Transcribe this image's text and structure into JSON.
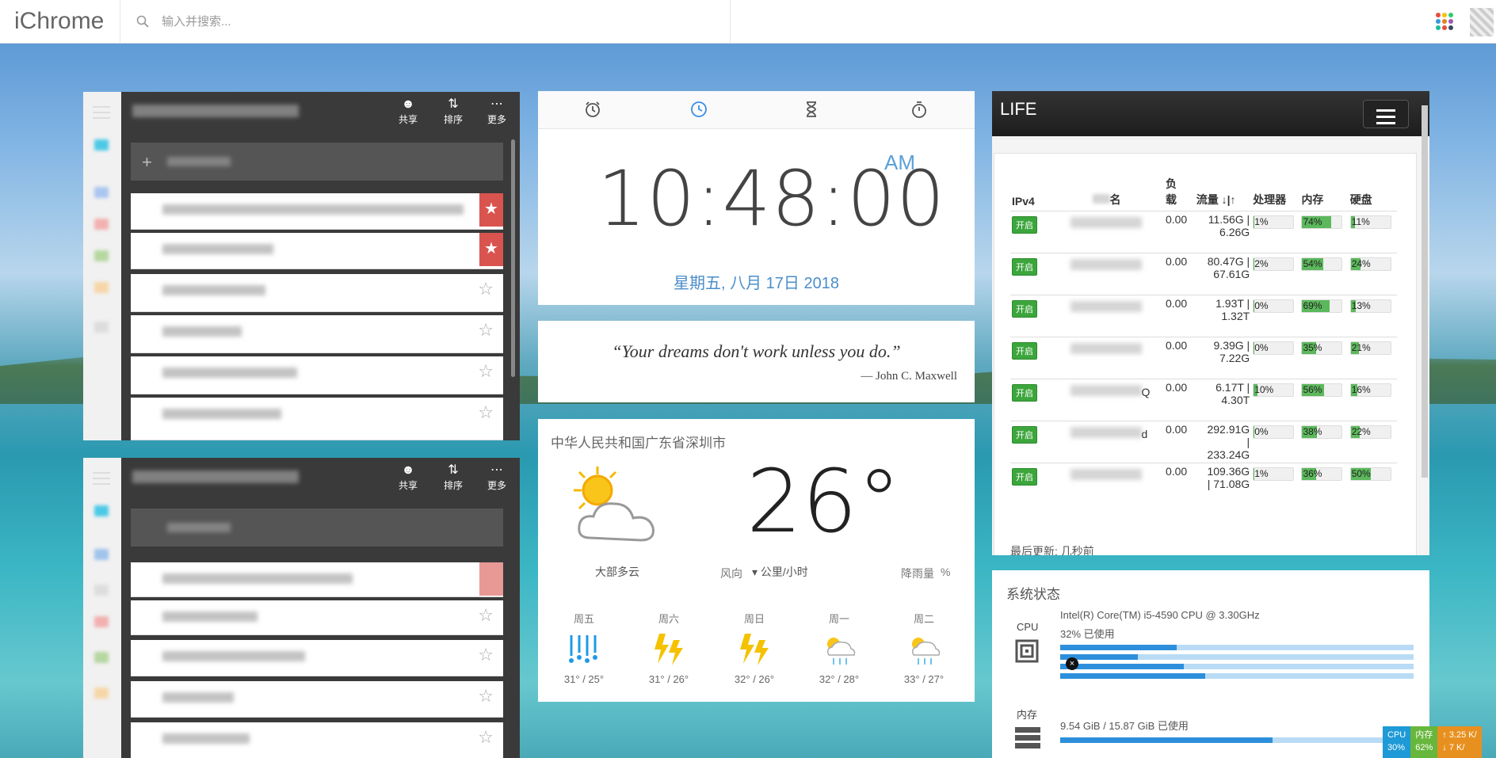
{
  "app": {
    "logo": "iChrome"
  },
  "search": {
    "placeholder": "输入并搜索..."
  },
  "colors": {
    "accent": "#4a8dc9",
    "green": "#5cb85c",
    "todo_dark": "#3a3a3a",
    "flag_red": "#d9534f"
  },
  "todo": {
    "toolbar": {
      "share": "共享",
      "sort": "排序",
      "more": "更多"
    }
  },
  "clock": {
    "time": "10:48:00",
    "ampm": "AM",
    "date": "星期五, 八月 17日 2018",
    "tabs": [
      "alarm-icon",
      "clock-icon",
      "hourglass-icon",
      "stopwatch-icon"
    ]
  },
  "quote": {
    "text": "“Your dreams don't work unless you do.”",
    "author": "— John C. Maxwell"
  },
  "weather": {
    "location": "中华人民共和国广东省深圳市",
    "temp": "26°",
    "condition": "大部多云",
    "wind_label": "风向",
    "wind_value": "公里/小时",
    "rain_label": "降雨量",
    "rain_value": "%",
    "forecast": [
      {
        "day": "周五",
        "temp": "31° / 25°",
        "icon": "rain-icon"
      },
      {
        "day": "周六",
        "temp": "31° / 26°",
        "icon": "thunder-icon"
      },
      {
        "day": "周日",
        "temp": "32° / 26°",
        "icon": "thunder-icon"
      },
      {
        "day": "周一",
        "temp": "32° / 28°",
        "icon": "sun-rain-icon"
      },
      {
        "day": "周二",
        "temp": "33° / 27°",
        "icon": "sun-rain-icon"
      }
    ]
  },
  "life": {
    "title": "LIFE",
    "headers": {
      "ipv4": "IPv4",
      "name": "名",
      "load_top": "负",
      "load_bottom": "载",
      "traffic": "流量 ↓|↑",
      "cpu": "处理器",
      "mem": "内存",
      "disk": "硬盘"
    },
    "status_label": "开启",
    "rows": [
      {
        "suffix": "",
        "load": "0.00",
        "traffic1": "11.56G |",
        "traffic2": "6.26G",
        "cpu": 1,
        "cpu_l": "1%",
        "mem": 74,
        "mem_l": "74%",
        "disk": 11,
        "disk_l": "11%"
      },
      {
        "suffix": "",
        "load": "0.00",
        "traffic1": "80.47G |",
        "traffic2": "67.61G",
        "cpu": 2,
        "cpu_l": "2%",
        "mem": 54,
        "mem_l": "54%",
        "disk": 24,
        "disk_l": "24%"
      },
      {
        "suffix": "",
        "load": "0.00",
        "traffic1": "1.93T |",
        "traffic2": "1.32T",
        "cpu": 0,
        "cpu_l": "0%",
        "mem": 69,
        "mem_l": "69%",
        "disk": 13,
        "disk_l": "13%"
      },
      {
        "suffix": "",
        "load": "0.00",
        "traffic1": "9.39G |",
        "traffic2": "7.22G",
        "cpu": 0,
        "cpu_l": "0%",
        "mem": 35,
        "mem_l": "35%",
        "disk": 21,
        "disk_l": "21%"
      },
      {
        "suffix": "Q",
        "load": "0.00",
        "traffic1": "6.17T |",
        "traffic2": "4.30T",
        "cpu": 10,
        "cpu_l": "10%",
        "mem": 56,
        "mem_l": "56%",
        "disk": 16,
        "disk_l": "16%"
      },
      {
        "suffix": "d",
        "load": "0.00",
        "traffic1": "292.91G",
        "traffic2": "|",
        "traffic3": "233.24G",
        "cpu": 0,
        "cpu_l": "0%",
        "mem": 38,
        "mem_l": "38%",
        "disk": 22,
        "disk_l": "22%"
      },
      {
        "suffix": "",
        "load": "0.00",
        "traffic1": "109.36G",
        "traffic2": "| 71.08G",
        "cpu": 1,
        "cpu_l": "1%",
        "mem": 36,
        "mem_l": "36%",
        "disk": 50,
        "disk_l": "50%"
      }
    ],
    "footer": "最后更新: 几秒前"
  },
  "system": {
    "title": "系统状态",
    "cpu_label": "CPU",
    "cpu_model": "Intel(R) Core(TM) i5-4590 CPU @ 3.30GHz",
    "cpu_usage": "32% 已使用",
    "cpu_cores": [
      0.33,
      0.22,
      0.35,
      0.41
    ],
    "mem_label": "内存",
    "mem_usage": "9.54 GiB / 15.87 GiB 已使用",
    "mem_fill": 0.6
  },
  "tray": {
    "cpu_label": "CPU",
    "cpu_value": "30%",
    "mem_label": "内存",
    "mem_value": "62%",
    "up": "3.25 K/",
    "down": "7 K/"
  }
}
